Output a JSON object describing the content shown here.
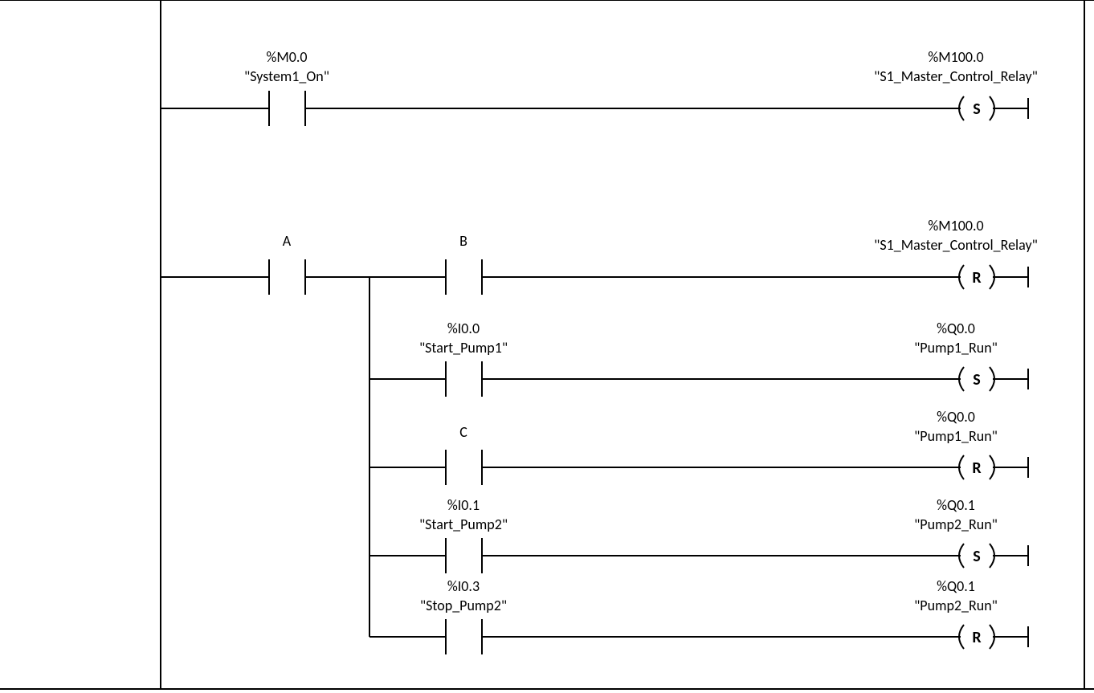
{
  "rungs": [
    {
      "contact": {
        "addr": "%M0.0",
        "name": "\"System1_On\""
      },
      "coil": {
        "addr": "%M100.0",
        "name": "\"S1_Master_Control_Relay\"",
        "letter": "S"
      }
    },
    {
      "contact": {
        "addr": "",
        "name": "A"
      },
      "branches": [
        {
          "contact": {
            "addr": "",
            "name": "B"
          },
          "coil": {
            "addr": "%M100.0",
            "name": "\"S1_Master_Control_Relay\"",
            "letter": "R"
          }
        },
        {
          "contact": {
            "addr": "%I0.0",
            "name": "\"Start_Pump1\""
          },
          "coil": {
            "addr": "%Q0.0",
            "name": "\"Pump1_Run\"",
            "letter": "S"
          }
        },
        {
          "contact": {
            "addr": "",
            "name": "C"
          },
          "coil": {
            "addr": "%Q0.0",
            "name": "\"Pump1_Run\"",
            "letter": "R"
          }
        },
        {
          "contact": {
            "addr": "%I0.1",
            "name": "\"Start_Pump2\""
          },
          "coil": {
            "addr": "%Q0.1",
            "name": "\"Pump2_Run\"",
            "letter": "S"
          }
        },
        {
          "contact": {
            "addr": "%I0.3",
            "name": "\"Stop_Pump2\""
          },
          "coil": {
            "addr": "%Q0.1",
            "name": "\"Pump2_Run\"",
            "letter": "R"
          }
        }
      ]
    }
  ]
}
